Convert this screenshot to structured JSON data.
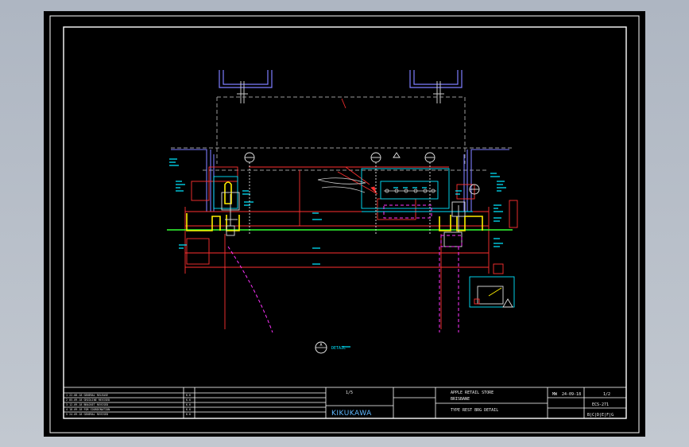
{
  "drawing": {
    "brand": "KIKUKAWA",
    "view_title": "TYPE REST BRG DETAIL",
    "project": "APPLE RETAIL STORE",
    "project_sub": "BRISBANE",
    "date": "24-09-18",
    "date_prefix": "MW",
    "sheet": "1/2",
    "drawing_no": "ECS-271",
    "revision_marks": "B|C|D|E|F|G",
    "scale_value": "1/5",
    "section_marker": "A",
    "section_label": "DETAIL"
  },
  "colors": {
    "background": "#000000",
    "frame": "#ffffff",
    "structure": "#9a9a9a",
    "steel_section": "#7d7dff",
    "dimension_red": "#ff3030",
    "annotation_cyan": "#00e5ff",
    "bracket_yellow": "#ffee00",
    "hidden_magenta": "#ff33ff",
    "level_green": "#33ff33",
    "brand_blue": "#5fb8ff"
  },
  "revisions": [
    {
      "text": "1   22-08-18 GENERAL RELEASE",
      "by": "K.K"
    },
    {
      "text": "2   05-09-18 GRIDLINE REVISED",
      "by": "K.K"
    },
    {
      "text": "3   12-09-18 BRACKET REVISED",
      "by": "K.K"
    },
    {
      "text": "4   18-09-18 FOR COORDINATION",
      "by": "K.K"
    },
    {
      "text": "5   24-09-18 GENERAL REVISED",
      "by": "K.K"
    }
  ]
}
